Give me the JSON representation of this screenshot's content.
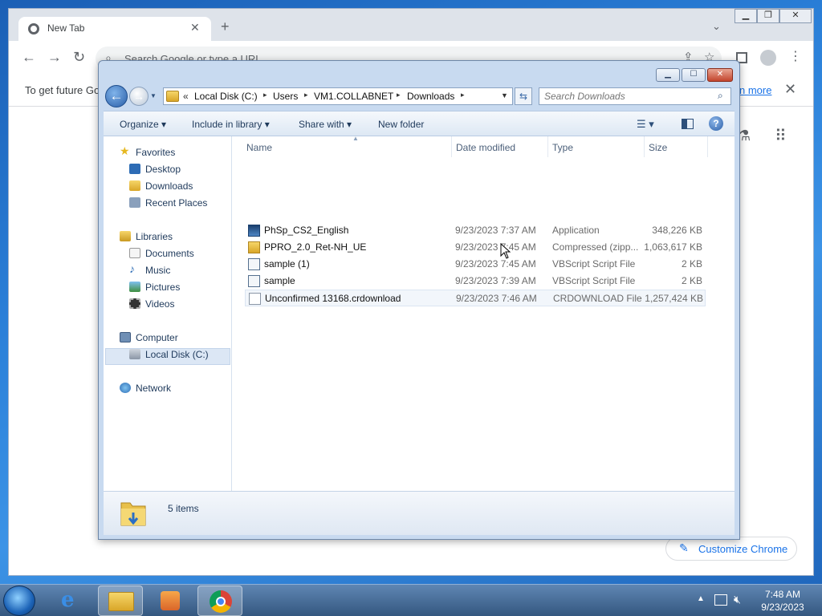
{
  "chrome": {
    "tab_title": "New Tab",
    "tab_close": "✕",
    "new_tab": "+",
    "tab_search": "⌄",
    "omnibox_placeholder": "Search Google or type a URL",
    "infobar_text": "To get future Go",
    "learn_more": "n more",
    "info_close": "✕",
    "customize_label": "Customize Chrome"
  },
  "explorer": {
    "breadcrumb": {
      "overflow": "«",
      "items": [
        "Local Disk (C:)",
        "Users",
        "VM1.COLLABNET",
        "Downloads"
      ],
      "sep": "▸"
    },
    "search_placeholder": "Search Downloads",
    "commands": {
      "organize": "Organize ▾",
      "include": "Include in library ▾",
      "share": "Share with ▾",
      "new_folder": "New folder"
    },
    "nav": {
      "favorites": "Favorites",
      "desktop": "Desktop",
      "downloads": "Downloads",
      "recent": "Recent Places",
      "libraries": "Libraries",
      "documents": "Documents",
      "music": "Music",
      "pictures": "Pictures",
      "videos": "Videos",
      "computer": "Computer",
      "local_disk": "Local Disk (C:)",
      "network": "Network"
    },
    "columns": {
      "name": "Name",
      "date": "Date modified",
      "type": "Type",
      "size": "Size"
    },
    "files": [
      {
        "name": "PhSp_CS2_English",
        "date": "9/23/2023 7:37 AM",
        "type": "Application",
        "size": "348,226 KB"
      },
      {
        "name": "PPRO_2.0_Ret-NH_UE",
        "date": "9/23/2023 7:45 AM",
        "type": "Compressed (zipp...",
        "size": "1,063,617 KB"
      },
      {
        "name": "sample (1)",
        "date": "9/23/2023 7:45 AM",
        "type": "VBScript Script File",
        "size": "2 KB"
      },
      {
        "name": "sample",
        "date": "9/23/2023 7:39 AM",
        "type": "VBScript Script File",
        "size": "2 KB"
      },
      {
        "name": "Unconfirmed 13168.crdownload",
        "date": "9/23/2023 7:46 AM",
        "type": "CRDOWNLOAD File",
        "size": "1,257,424 KB"
      }
    ],
    "status": "5 items"
  },
  "taskbar": {
    "time": "7:48 AM",
    "date": "9/23/2023"
  },
  "colors": {
    "accent": "#1a73e8",
    "explorer_frame": "#c8daf0",
    "taskbar": "#34577f"
  },
  "icons": [
    "chrome-logo-icon",
    "plus-icon",
    "back-arrow-icon",
    "forward-arrow-icon",
    "reload-icon",
    "share-icon",
    "star-icon",
    "sidepanel-icon",
    "profile-icon",
    "kebab-menu-icon",
    "pencil-icon",
    "folder-icon",
    "search-icon",
    "refresh-icon",
    "views-icon",
    "preview-pane-icon",
    "help-icon",
    "star-favorites-icon",
    "library-icon",
    "computer-icon",
    "drive-icon",
    "network-icon",
    "application-icon",
    "zip-folder-icon",
    "script-icon",
    "file-icon",
    "start-orb-icon",
    "ie-icon",
    "explorer-icon",
    "media-player-icon",
    "chrome-taskbar-icon",
    "mouse-cursor-icon"
  ]
}
